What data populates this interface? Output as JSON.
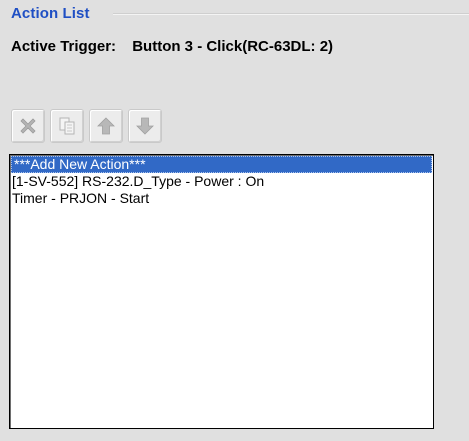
{
  "group": {
    "title": "Action List"
  },
  "trigger": {
    "label": "Active Trigger:",
    "value": "Button 3 - Click(RC-63DL: 2)"
  },
  "toolbar": {
    "buttons": [
      {
        "name": "delete",
        "icon": "x-icon",
        "enabled": false
      },
      {
        "name": "copy",
        "icon": "copy-icon",
        "enabled": false
      },
      {
        "name": "move-up",
        "icon": "arrow-up-icon",
        "enabled": false
      },
      {
        "name": "move-down",
        "icon": "arrow-down-icon",
        "enabled": false
      }
    ]
  },
  "actions": {
    "selected_index": 0,
    "items": [
      {
        "label": "***Add New Action***"
      },
      {
        "label": "[1-SV-552] RS-232.D_Type - Power : On"
      },
      {
        "label": "Timer - PRJON - Start"
      }
    ]
  },
  "colors": {
    "group_title": "#1f4fc4",
    "selection_bg": "#3169c6",
    "icon_disabled": "#b8b8b8",
    "background": "#e0e0e0"
  }
}
